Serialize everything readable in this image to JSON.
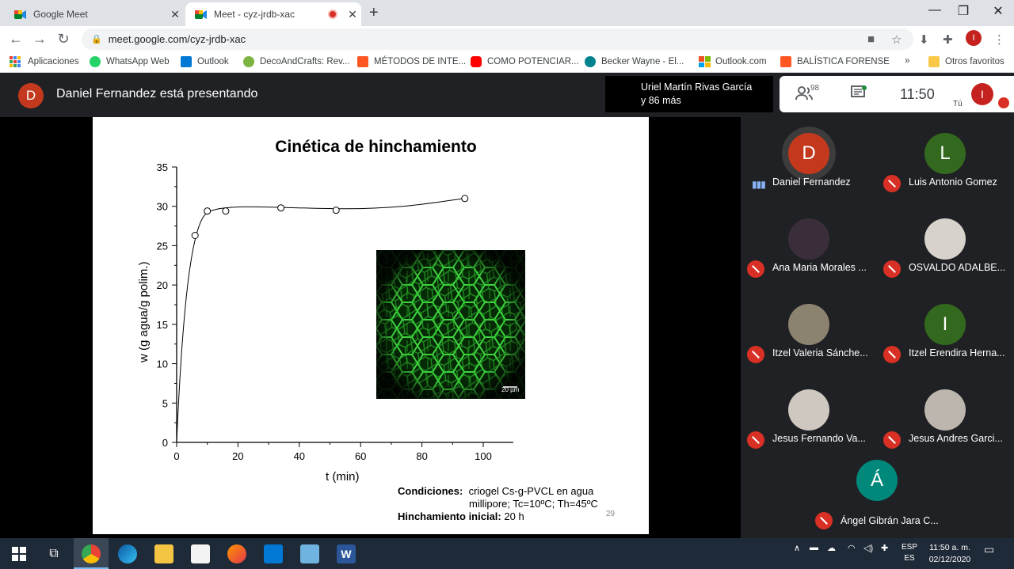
{
  "browser": {
    "tabs": [
      {
        "title": "Google Meet",
        "active": false
      },
      {
        "title": "Meet - cyz-jrdb-xac",
        "active": true,
        "recording": true
      }
    ],
    "url": "meet.google.com/cyz-jrdb-xac",
    "profile_initial": "I",
    "bookmarks": [
      {
        "label": "Aplicaciones",
        "icon": "apps-grid-icon",
        "color": "#4285f4"
      },
      {
        "label": "WhatsApp Web",
        "icon": "whatsapp-icon",
        "color": "#25d366"
      },
      {
        "label": "Outlook",
        "icon": "outlook-icon",
        "color": "#0078d4"
      },
      {
        "label": "DecoAndCrafts: Rev...",
        "icon": "decocrafts-icon",
        "color": "#7cb342"
      },
      {
        "label": "MÉTODOS DE INTE...",
        "icon": "blogger-icon",
        "color": "#ff5722"
      },
      {
        "label": "COMO POTENCIAR...",
        "icon": "youtube-icon",
        "color": "#ff0000"
      },
      {
        "label": "Becker Wayne - El...",
        "icon": "web-icon",
        "color": "#00838f"
      },
      {
        "label": "Outlook.com",
        "icon": "microsoft-icon",
        "color": "#f25022"
      },
      {
        "label": "BALÍSTICA FORENSE",
        "icon": "blogger-icon",
        "color": "#ff5722"
      }
    ],
    "more_bookmarks": "»",
    "other_favorites": "Otros favoritos"
  },
  "meet": {
    "presenter_initial": "D",
    "presenting_text": "Daniel Fernandez está presentando",
    "speaker_line1": "Uriel Martín Rivas García",
    "speaker_line2": "y 86 más",
    "people_count": "98",
    "time": "11:50",
    "me_initial": "I",
    "me_label": "Tú",
    "participants": [
      {
        "name": "Daniel Fernandez",
        "initial": "D",
        "color": "#c4391d",
        "speaking": true
      },
      {
        "name": "Luis Antonio Gomez",
        "initial": "L",
        "color": "#33691e",
        "muted": true
      },
      {
        "name": "Ana Maria Morales ...",
        "photo": true,
        "muted": true
      },
      {
        "name": "OSVALDO ADALBE...",
        "photo": true,
        "muted": true
      },
      {
        "name": "Itzel Valeria Sánche...",
        "photo": true,
        "muted": true
      },
      {
        "name": "Itzel Erendira Herna...",
        "initial": "I",
        "color": "#33691e",
        "muted": true
      },
      {
        "name": "Jesus Fernando Va...",
        "photo": true,
        "muted": true
      },
      {
        "name": "Jesus Andres Garci...",
        "photo": true,
        "muted": true
      }
    ],
    "last_participant": {
      "name": "Ángel Gibrán Jara C...",
      "initial": "Á",
      "color": "#00897b",
      "muted": true
    }
  },
  "slide": {
    "title": "Cinética de hinchamiento",
    "scale_label": "20 µm",
    "conditions_label": "Condiciones:",
    "conditions_text1": "criogel Cs-g-PVCL en agua",
    "conditions_text2": "millipore; Tc=10ºC; Th=45ºC",
    "initial_label": "Hinchamiento inicial:",
    "initial_value": "20 h",
    "page_number": "29"
  },
  "chart_data": {
    "type": "scatter",
    "title": "",
    "xlabel": "t (min)",
    "ylabel": "w (g agua/g polim.)",
    "xlim": [
      0,
      100
    ],
    "ylim": [
      0,
      35
    ],
    "xticks": [
      0,
      20,
      40,
      60,
      80,
      100
    ],
    "yticks": [
      0,
      5,
      10,
      15,
      20,
      25,
      30,
      35
    ],
    "series": [
      {
        "x": [
          0,
          6,
          10,
          16,
          34,
          52,
          94
        ],
        "y": [
          0,
          26.3,
          29.4,
          29.4,
          29.8,
          29.5,
          31.0
        ],
        "marker": "open-circle",
        "fit_line": true
      }
    ]
  },
  "taskbar": {
    "lang_top": "ESP",
    "lang_bottom": "ES",
    "time": "11:50 a. m.",
    "date": "02/12/2020"
  }
}
